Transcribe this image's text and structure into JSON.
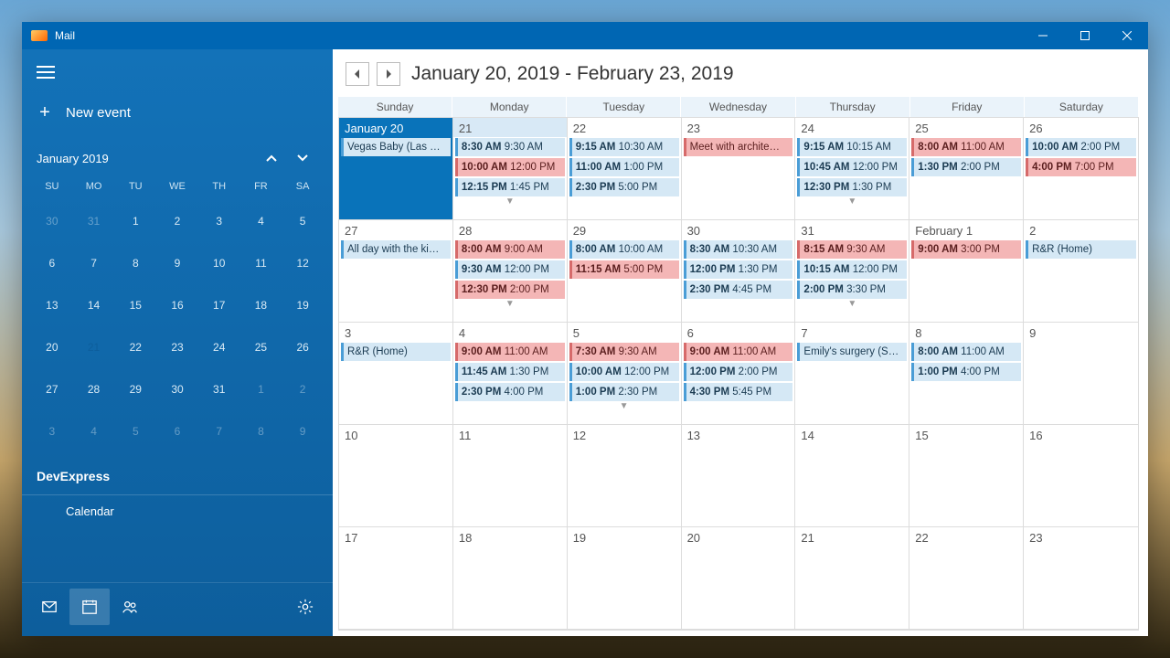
{
  "title": "Mail",
  "sidebar": {
    "new_event": "New event",
    "month_label": "January 2019",
    "dow": [
      "SU",
      "MO",
      "TU",
      "WE",
      "TH",
      "FR",
      "SA"
    ],
    "weeks": [
      [
        {
          "n": "30",
          "cls": "dim"
        },
        {
          "n": "31",
          "cls": "dim"
        },
        {
          "n": "1"
        },
        {
          "n": "2"
        },
        {
          "n": "3"
        },
        {
          "n": "4"
        },
        {
          "n": "5"
        }
      ],
      [
        {
          "n": "6"
        },
        {
          "n": "7"
        },
        {
          "n": "8"
        },
        {
          "n": "9"
        },
        {
          "n": "10"
        },
        {
          "n": "11"
        },
        {
          "n": "12"
        }
      ],
      [
        {
          "n": "13"
        },
        {
          "n": "14",
          "cls": "high"
        },
        {
          "n": "15",
          "cls": "high"
        },
        {
          "n": "16",
          "cls": "high"
        },
        {
          "n": "17",
          "cls": "high"
        },
        {
          "n": "18"
        },
        {
          "n": "19"
        }
      ],
      [
        {
          "n": "20"
        },
        {
          "n": "21",
          "cls": "sel today"
        },
        {
          "n": "22",
          "cls": "high"
        },
        {
          "n": "23",
          "cls": "high"
        },
        {
          "n": "24"
        },
        {
          "n": "25"
        },
        {
          "n": "26"
        }
      ],
      [
        {
          "n": "27"
        },
        {
          "n": "28"
        },
        {
          "n": "29"
        },
        {
          "n": "30"
        },
        {
          "n": "31"
        },
        {
          "n": "1",
          "cls": "dim"
        },
        {
          "n": "2",
          "cls": "dim"
        }
      ],
      [
        {
          "n": "3",
          "cls": "dim"
        },
        {
          "n": "4",
          "cls": "dim"
        },
        {
          "n": "5",
          "cls": "dim"
        },
        {
          "n": "6",
          "cls": "dim"
        },
        {
          "n": "7",
          "cls": "dim"
        },
        {
          "n": "8",
          "cls": "dim"
        },
        {
          "n": "9",
          "cls": "dim"
        }
      ]
    ],
    "account": "DevExpress",
    "calendar": "Calendar"
  },
  "main": {
    "range": "January 20, 2019 - February 23, 2019",
    "dow": [
      "Sunday",
      "Monday",
      "Tuesday",
      "Wednesday",
      "Thursday",
      "Friday",
      "Saturday"
    ],
    "cells": [
      {
        "label": "January 20",
        "cls": "highlight",
        "events": [
          {
            "text": "Vegas Baby (Las V…",
            "c": "blue"
          }
        ]
      },
      {
        "label": "21",
        "cls": "accent",
        "events": [
          {
            "t1": "8:30 AM",
            "t2": "9:30 AM",
            "c": "blue"
          },
          {
            "t1": "10:00 AM",
            "t2": "12:00 PM",
            "c": "red"
          },
          {
            "t1": "12:15 PM",
            "t2": "1:45 PM",
            "c": "blue"
          }
        ],
        "more": true
      },
      {
        "label": "22",
        "events": [
          {
            "t1": "9:15 AM",
            "t2": "10:30 AM",
            "c": "blue"
          },
          {
            "t1": "11:00 AM",
            "t2": "1:00 PM",
            "c": "blue"
          },
          {
            "t1": "2:30 PM",
            "t2": "5:00 PM",
            "c": "blue"
          }
        ]
      },
      {
        "label": "23",
        "events": [
          {
            "text": "Meet with archite…",
            "c": "red"
          }
        ]
      },
      {
        "label": "24",
        "events": [
          {
            "t1": "9:15 AM",
            "t2": "10:15 AM",
            "c": "blue"
          },
          {
            "t1": "10:45 AM",
            "t2": "12:00 PM",
            "c": "blue"
          },
          {
            "t1": "12:30 PM",
            "t2": "1:30 PM",
            "c": "blue"
          }
        ],
        "more": true
      },
      {
        "label": "25",
        "events": [
          {
            "t1": "8:00 AM",
            "t2": "11:00 AM",
            "c": "red"
          },
          {
            "t1": "1:30 PM",
            "t2": "2:00 PM",
            "c": "blue"
          }
        ]
      },
      {
        "label": "26",
        "events": [
          {
            "t1": "10:00 AM",
            "t2": "2:00 PM",
            "c": "blue"
          },
          {
            "t1": "4:00 PM",
            "t2": "7:00 PM",
            "c": "red"
          }
        ]
      },
      {
        "label": "27",
        "events": [
          {
            "text": "All day with the ki…",
            "c": "blue"
          }
        ]
      },
      {
        "label": "28",
        "events": [
          {
            "t1": "8:00 AM",
            "t2": "9:00 AM",
            "c": "red"
          },
          {
            "t1": "9:30 AM",
            "t2": "12:00 PM",
            "c": "blue"
          },
          {
            "t1": "12:30 PM",
            "t2": "2:00 PM",
            "c": "red"
          }
        ],
        "more": true
      },
      {
        "label": "29",
        "events": [
          {
            "t1": "8:00 AM",
            "t2": "10:00 AM",
            "c": "blue"
          },
          {
            "t1": "11:15 AM",
            "t2": "5:00 PM",
            "c": "red"
          }
        ]
      },
      {
        "label": "30",
        "events": [
          {
            "t1": "8:30 AM",
            "t2": "10:30 AM",
            "c": "blue"
          },
          {
            "t1": "12:00 PM",
            "t2": "1:30 PM",
            "c": "blue"
          },
          {
            "t1": "2:30 PM",
            "t2": "4:45 PM",
            "c": "blue"
          }
        ]
      },
      {
        "label": "31",
        "events": [
          {
            "t1": "8:15 AM",
            "t2": "9:30 AM",
            "c": "red"
          },
          {
            "t1": "10:15 AM",
            "t2": "12:00 PM",
            "c": "blue"
          },
          {
            "t1": "2:00 PM",
            "t2": "3:30 PM",
            "c": "blue"
          }
        ],
        "more": true
      },
      {
        "label": "February 1",
        "events": [
          {
            "t1": "9:00 AM",
            "t2": "3:00 PM",
            "c": "red"
          }
        ]
      },
      {
        "label": "2",
        "events": [
          {
            "text": "R&R (Home)",
            "c": "blue"
          }
        ]
      },
      {
        "label": "3",
        "events": [
          {
            "text": "R&R (Home)",
            "c": "blue"
          }
        ]
      },
      {
        "label": "4",
        "events": [
          {
            "t1": "9:00 AM",
            "t2": "11:00 AM",
            "c": "red"
          },
          {
            "t1": "11:45 AM",
            "t2": "1:30 PM",
            "c": "blue"
          },
          {
            "t1": "2:30 PM",
            "t2": "4:00 PM",
            "c": "blue"
          }
        ]
      },
      {
        "label": "5",
        "events": [
          {
            "t1": "7:30 AM",
            "t2": "9:30 AM",
            "c": "red"
          },
          {
            "t1": "10:00 AM",
            "t2": "12:00 PM",
            "c": "blue"
          },
          {
            "t1": "1:00 PM",
            "t2": "2:30 PM",
            "c": "blue"
          }
        ],
        "more": true
      },
      {
        "label": "6",
        "events": [
          {
            "t1": "9:00 AM",
            "t2": "11:00 AM",
            "c": "red"
          },
          {
            "t1": "12:00 PM",
            "t2": "2:00 PM",
            "c": "blue"
          },
          {
            "t1": "4:30 PM",
            "t2": "5:45 PM",
            "c": "blue"
          }
        ]
      },
      {
        "label": "7",
        "events": [
          {
            "text": "Emily's surgery (S…",
            "c": "blue"
          }
        ]
      },
      {
        "label": "8",
        "events": [
          {
            "t1": "8:00 AM",
            "t2": "11:00 AM",
            "c": "blue"
          },
          {
            "t1": "1:00 PM",
            "t2": "4:00 PM",
            "c": "blue"
          }
        ]
      },
      {
        "label": "9",
        "events": []
      },
      {
        "label": "10",
        "events": []
      },
      {
        "label": "11",
        "events": []
      },
      {
        "label": "12",
        "events": []
      },
      {
        "label": "13",
        "events": []
      },
      {
        "label": "14",
        "events": []
      },
      {
        "label": "15",
        "events": []
      },
      {
        "label": "16",
        "events": []
      },
      {
        "label": "17",
        "events": []
      },
      {
        "label": "18",
        "events": []
      },
      {
        "label": "19",
        "events": []
      },
      {
        "label": "20",
        "events": []
      },
      {
        "label": "21",
        "events": []
      },
      {
        "label": "22",
        "events": []
      },
      {
        "label": "23",
        "events": []
      }
    ]
  }
}
